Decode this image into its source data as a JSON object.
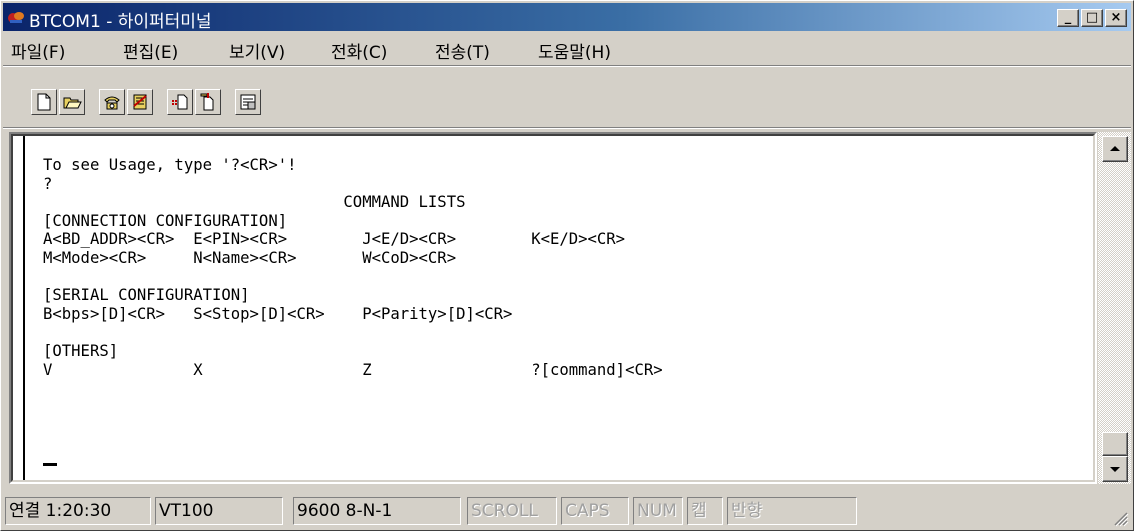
{
  "window": {
    "title": "BTCOM1 - 하이퍼터미널"
  },
  "titlebar_buttons": {
    "minimize": "_",
    "maximize": "□",
    "close": "×"
  },
  "menu": [
    {
      "label": "파일(F)"
    },
    {
      "label": "편집(E)"
    },
    {
      "label": "보기(V)"
    },
    {
      "label": "전화(C)"
    },
    {
      "label": "전송(T)"
    },
    {
      "label": "도움말(H)"
    }
  ],
  "toolbar": [
    {
      "icon": "new-document-icon"
    },
    {
      "icon": "open-folder-icon"
    },
    {
      "icon": "call-icon"
    },
    {
      "icon": "disconnect-icon"
    },
    {
      "icon": "send-file-icon"
    },
    {
      "icon": "receive-file-icon"
    },
    {
      "icon": "properties-icon"
    }
  ],
  "terminal": {
    "lines": [
      "To see Usage, type '?<CR>'!",
      "?",
      "                                COMMAND LISTS",
      "[CONNECTION CONFIGURATION]",
      "A<BD_ADDR><CR>  E<PIN><CR>        J<E/D><CR>        K<E/D><CR>",
      "M<Mode><CR>     N<Name><CR>       W<CoD><CR>",
      "",
      "[SERIAL CONFIGURATION]",
      "B<bps>[D]<CR>   S<Stop>[D]<CR>    P<Parity>[D]<CR>",
      "",
      "[OTHERS]",
      "V               X                 Z                 ?[command]<CR>"
    ]
  },
  "status": {
    "connection": "연결 1:20:30",
    "emulation": "VT100",
    "port_settings": "9600 8-N-1",
    "scroll": "SCROLL",
    "caps": "CAPS",
    "num": "NUM",
    "kor": "캡",
    "echo": "반향"
  },
  "colors": {
    "titlebar_start": "#0a246a",
    "titlebar_end": "#a6caf0",
    "face": "#d4d0c8"
  }
}
